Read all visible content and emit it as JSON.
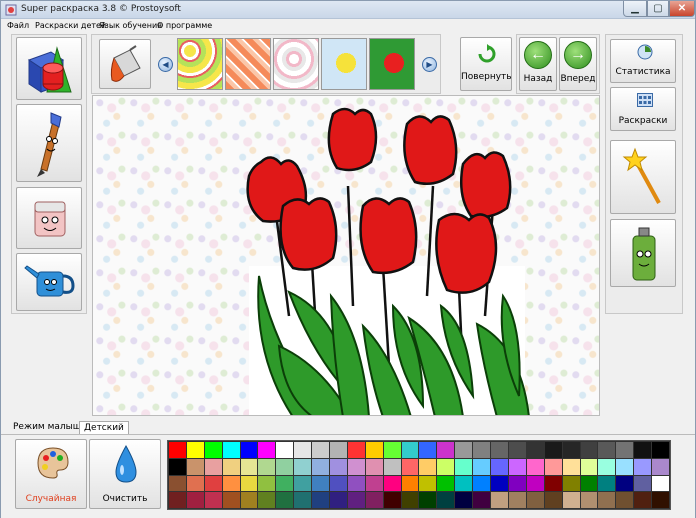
{
  "window": {
    "title": "Super раскраска 3.8 © Prostoysoft"
  },
  "menu": {
    "items": [
      "Файл",
      "Раскраски детей",
      "Язык обучения",
      "О программе"
    ]
  },
  "toolbar": {
    "rotate_label": "Повернуть",
    "back_label": "Назад",
    "forward_label": "Вперед",
    "stats_label": "Статистика",
    "pages_label": "Раскраски"
  },
  "tabs": {
    "baby": "Режим малыш",
    "kids": "Детский"
  },
  "bottom": {
    "random_label": "Случайная",
    "clear_label": "Очистить"
  },
  "colors": {
    "accent_red": "#d91a1a",
    "leaf_green": "#2e9a2a",
    "random_label_color": "#e0401e"
  },
  "palette": [
    "#ff0000",
    "#ffff00",
    "#00ff00",
    "#00ffff",
    "#0000ff",
    "#ff00ff",
    "#ffffff",
    "#e6e6e6",
    "#cccccc",
    "#b3b3b3",
    "#ff3333",
    "#ffcc00",
    "#66ff33",
    "#33cccc",
    "#3366ff",
    "#cc33cc",
    "#999999",
    "#808080",
    "#666666",
    "#4d4d4d",
    "#333333",
    "#1a1a1a",
    "#262626",
    "#404040",
    "#595959",
    "#737373",
    "#111111",
    "#000000",
    "#000000",
    "#c9936b",
    "#e8a0a0",
    "#f0d080",
    "#e6e694",
    "#b0d890",
    "#90d0a0",
    "#90d0d0",
    "#90b0e0",
    "#a090e0",
    "#d090d0",
    "#e090b0",
    "#c0c0c0",
    "#ff6666",
    "#ffcc66",
    "#ccff66",
    "#66ffcc",
    "#66ccff",
    "#6666ff",
    "#cc66ff",
    "#ff66cc",
    "#ff9999",
    "#ffe099",
    "#e0ff99",
    "#99ffe0",
    "#99e0ff",
    "#9999ff",
    "#aa88cc",
    "#8a5030",
    "#e07050",
    "#e04040",
    "#ff9040",
    "#e8d840",
    "#90c040",
    "#40b060",
    "#40a0a0",
    "#4080c0",
    "#5050c0",
    "#9050c0",
    "#c04090",
    "#ff0080",
    "#ff8000",
    "#c0c000",
    "#00c000",
    "#00c0c0",
    "#0080ff",
    "#0000c0",
    "#8000c0",
    "#c000c0",
    "#800000",
    "#808000",
    "#008000",
    "#008080",
    "#000080",
    "#6060a0",
    "#ffffff",
    "#702020",
    "#a02040",
    "#c03050",
    "#a05020",
    "#a08020",
    "#608020",
    "#207040",
    "#207070",
    "#204080",
    "#302080",
    "#602080",
    "#802060",
    "#400000",
    "#404000",
    "#004000",
    "#004040",
    "#000040",
    "#400040",
    "#c0a080",
    "#a08060",
    "#806040",
    "#604020",
    "#d0b090",
    "#b09070",
    "#907050",
    "#705030",
    "#502010",
    "#301000"
  ]
}
